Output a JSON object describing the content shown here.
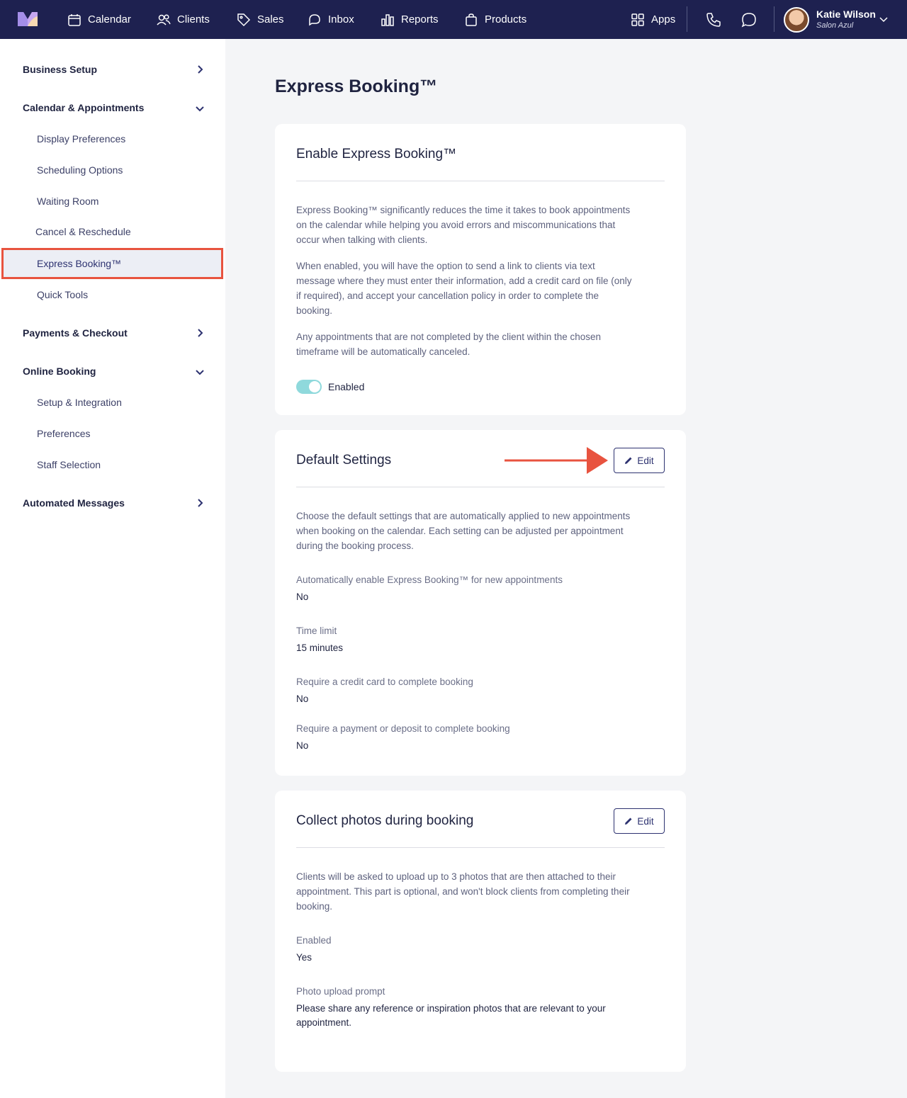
{
  "nav": {
    "items": [
      {
        "label": "Calendar",
        "icon": "calendar-icon"
      },
      {
        "label": "Clients",
        "icon": "users-icon"
      },
      {
        "label": "Sales",
        "icon": "tag-icon"
      },
      {
        "label": "Inbox",
        "icon": "inbox-icon"
      },
      {
        "label": "Reports",
        "icon": "bar-chart-icon"
      },
      {
        "label": "Products",
        "icon": "shopping-bag-icon"
      }
    ],
    "apps_label": "Apps",
    "user": {
      "name": "Katie Wilson",
      "salon": "Salon Azul"
    }
  },
  "sidebar": {
    "business_setup": "Business Setup",
    "calendar_appointments": "Calendar & Appointments",
    "calendar_items": [
      "Display Preferences",
      "Scheduling Options",
      "Waiting Room",
      "Cancel & Reschedule",
      "Express Booking™",
      "Quick Tools"
    ],
    "payments_checkout": "Payments & Checkout",
    "online_booking": "Online Booking",
    "online_items": [
      "Setup & Integration",
      "Preferences",
      "Staff Selection"
    ],
    "automated_messages": "Automated Messages"
  },
  "page": {
    "title": "Express Booking™"
  },
  "enable_card": {
    "title": "Enable Express Booking™",
    "paragraphs": [
      "Express Booking™ significantly reduces the time it takes to book appointments on the calendar while helping you avoid errors and miscommunications that occur when talking with clients.",
      "When enabled, you will have the option to send a link to clients via text message where they must enter their information, add a credit card on file (only if required), and accept your cancellation policy in order to complete the booking.",
      "Any appointments that are not completed by the client within the chosen timeframe will be automatically canceled."
    ],
    "toggle_label": "Enabled",
    "toggle_on": true
  },
  "default_card": {
    "title": "Default Settings",
    "edit_label": "Edit",
    "description": "Choose the default settings that are automatically applied to new appointments when booking on the calendar. Each setting can be adjusted per appointment during the booking process.",
    "fields": [
      {
        "label": "Automatically enable Express Booking™ for new appointments",
        "value": "No"
      },
      {
        "label": "Time limit",
        "value": "15 minutes"
      },
      {
        "label": "Require a credit card to complete booking",
        "value": "No"
      },
      {
        "label": "Require a payment or deposit to complete booking",
        "value": "No"
      }
    ]
  },
  "photos_card": {
    "title": "Collect photos during booking",
    "edit_label": "Edit",
    "description": "Clients will be asked to upload up to 3 photos that are then attached to their appointment. This part is optional, and won't block clients from completing their booking.",
    "fields": [
      {
        "label": "Enabled",
        "value": "Yes"
      },
      {
        "label": "Photo upload prompt",
        "value": "Please share any reference or inspiration photos that are relevant to your appointment."
      }
    ]
  },
  "colors": {
    "nav_bg": "#1e2150",
    "accent": "#2d3270",
    "highlight": "#e8533f",
    "toggle": "#8fd9dc"
  }
}
